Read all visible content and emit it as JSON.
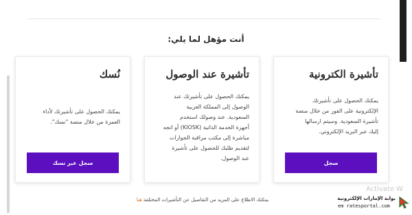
{
  "heading": "أنت مؤهل لما يلي:",
  "cards": [
    {
      "title": "تأشيرة الكترونية",
      "description": [
        "يمكنك الحصول على تأشيرتك",
        "الإلكترونية على الفور من خلال منصة",
        "تأشيرة السعودية. وسيتم ارسالها",
        "إليك عبر البريد الإلكتروني."
      ],
      "button": "سجل"
    },
    {
      "title": "تأشيرة عند الوصول",
      "description": [
        "يمكنك الحصول على تأشيرتك عند",
        "الوصول إلى المملكة العربية",
        "السعودية. عند وصولك استخدم",
        "أجهزة الخدمة الذاتية (KIOSK) أو اتجه",
        "مباشرة إلى مكتب مراقبة الجوازات",
        "لتقديم طلبك للحصول على تأشيرة",
        "عند الوصول."
      ],
      "button": ""
    },
    {
      "title": "نُسك",
      "description": [
        "يمكنك الحصول على تأشيرتك لأداء",
        "العمرة من خلال منصة \"نسك\"."
      ],
      "button": "سجل عبر نسك"
    }
  ],
  "footer": {
    "text": "يمكنك الاطلاع على المزيد من التفاصيل عن التأشيرات المختلفة",
    "link": "هنا"
  },
  "watermark": "Activate W",
  "portal_badge": {
    "name": "بوابة الإمارات الإلكترونية",
    "url": "em ratesportal.com"
  },
  "colors": {
    "button": "#5b0fbf",
    "link": "#e06b10"
  }
}
